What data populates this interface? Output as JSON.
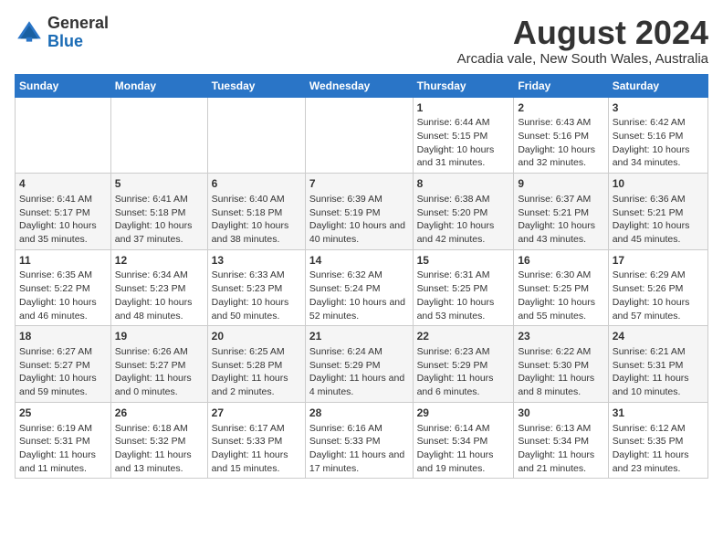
{
  "header": {
    "logo_general": "General",
    "logo_blue": "Blue",
    "month_year": "August 2024",
    "location": "Arcadia vale, New South Wales, Australia"
  },
  "days_of_week": [
    "Sunday",
    "Monday",
    "Tuesday",
    "Wednesday",
    "Thursday",
    "Friday",
    "Saturday"
  ],
  "weeks": [
    [
      {
        "day": "",
        "sunrise": "",
        "sunset": "",
        "daylight": ""
      },
      {
        "day": "",
        "sunrise": "",
        "sunset": "",
        "daylight": ""
      },
      {
        "day": "",
        "sunrise": "",
        "sunset": "",
        "daylight": ""
      },
      {
        "day": "",
        "sunrise": "",
        "sunset": "",
        "daylight": ""
      },
      {
        "day": "1",
        "sunrise": "Sunrise: 6:44 AM",
        "sunset": "Sunset: 5:15 PM",
        "daylight": "Daylight: 10 hours and 31 minutes."
      },
      {
        "day": "2",
        "sunrise": "Sunrise: 6:43 AM",
        "sunset": "Sunset: 5:16 PM",
        "daylight": "Daylight: 10 hours and 32 minutes."
      },
      {
        "day": "3",
        "sunrise": "Sunrise: 6:42 AM",
        "sunset": "Sunset: 5:16 PM",
        "daylight": "Daylight: 10 hours and 34 minutes."
      }
    ],
    [
      {
        "day": "4",
        "sunrise": "Sunrise: 6:41 AM",
        "sunset": "Sunset: 5:17 PM",
        "daylight": "Daylight: 10 hours and 35 minutes."
      },
      {
        "day": "5",
        "sunrise": "Sunrise: 6:41 AM",
        "sunset": "Sunset: 5:18 PM",
        "daylight": "Daylight: 10 hours and 37 minutes."
      },
      {
        "day": "6",
        "sunrise": "Sunrise: 6:40 AM",
        "sunset": "Sunset: 5:18 PM",
        "daylight": "Daylight: 10 hours and 38 minutes."
      },
      {
        "day": "7",
        "sunrise": "Sunrise: 6:39 AM",
        "sunset": "Sunset: 5:19 PM",
        "daylight": "Daylight: 10 hours and 40 minutes."
      },
      {
        "day": "8",
        "sunrise": "Sunrise: 6:38 AM",
        "sunset": "Sunset: 5:20 PM",
        "daylight": "Daylight: 10 hours and 42 minutes."
      },
      {
        "day": "9",
        "sunrise": "Sunrise: 6:37 AM",
        "sunset": "Sunset: 5:21 PM",
        "daylight": "Daylight: 10 hours and 43 minutes."
      },
      {
        "day": "10",
        "sunrise": "Sunrise: 6:36 AM",
        "sunset": "Sunset: 5:21 PM",
        "daylight": "Daylight: 10 hours and 45 minutes."
      }
    ],
    [
      {
        "day": "11",
        "sunrise": "Sunrise: 6:35 AM",
        "sunset": "Sunset: 5:22 PM",
        "daylight": "Daylight: 10 hours and 46 minutes."
      },
      {
        "day": "12",
        "sunrise": "Sunrise: 6:34 AM",
        "sunset": "Sunset: 5:23 PM",
        "daylight": "Daylight: 10 hours and 48 minutes."
      },
      {
        "day": "13",
        "sunrise": "Sunrise: 6:33 AM",
        "sunset": "Sunset: 5:23 PM",
        "daylight": "Daylight: 10 hours and 50 minutes."
      },
      {
        "day": "14",
        "sunrise": "Sunrise: 6:32 AM",
        "sunset": "Sunset: 5:24 PM",
        "daylight": "Daylight: 10 hours and 52 minutes."
      },
      {
        "day": "15",
        "sunrise": "Sunrise: 6:31 AM",
        "sunset": "Sunset: 5:25 PM",
        "daylight": "Daylight: 10 hours and 53 minutes."
      },
      {
        "day": "16",
        "sunrise": "Sunrise: 6:30 AM",
        "sunset": "Sunset: 5:25 PM",
        "daylight": "Daylight: 10 hours and 55 minutes."
      },
      {
        "day": "17",
        "sunrise": "Sunrise: 6:29 AM",
        "sunset": "Sunset: 5:26 PM",
        "daylight": "Daylight: 10 hours and 57 minutes."
      }
    ],
    [
      {
        "day": "18",
        "sunrise": "Sunrise: 6:27 AM",
        "sunset": "Sunset: 5:27 PM",
        "daylight": "Daylight: 10 hours and 59 minutes."
      },
      {
        "day": "19",
        "sunrise": "Sunrise: 6:26 AM",
        "sunset": "Sunset: 5:27 PM",
        "daylight": "Daylight: 11 hours and 0 minutes."
      },
      {
        "day": "20",
        "sunrise": "Sunrise: 6:25 AM",
        "sunset": "Sunset: 5:28 PM",
        "daylight": "Daylight: 11 hours and 2 minutes."
      },
      {
        "day": "21",
        "sunrise": "Sunrise: 6:24 AM",
        "sunset": "Sunset: 5:29 PM",
        "daylight": "Daylight: 11 hours and 4 minutes."
      },
      {
        "day": "22",
        "sunrise": "Sunrise: 6:23 AM",
        "sunset": "Sunset: 5:29 PM",
        "daylight": "Daylight: 11 hours and 6 minutes."
      },
      {
        "day": "23",
        "sunrise": "Sunrise: 6:22 AM",
        "sunset": "Sunset: 5:30 PM",
        "daylight": "Daylight: 11 hours and 8 minutes."
      },
      {
        "day": "24",
        "sunrise": "Sunrise: 6:21 AM",
        "sunset": "Sunset: 5:31 PM",
        "daylight": "Daylight: 11 hours and 10 minutes."
      }
    ],
    [
      {
        "day": "25",
        "sunrise": "Sunrise: 6:19 AM",
        "sunset": "Sunset: 5:31 PM",
        "daylight": "Daylight: 11 hours and 11 minutes."
      },
      {
        "day": "26",
        "sunrise": "Sunrise: 6:18 AM",
        "sunset": "Sunset: 5:32 PM",
        "daylight": "Daylight: 11 hours and 13 minutes."
      },
      {
        "day": "27",
        "sunrise": "Sunrise: 6:17 AM",
        "sunset": "Sunset: 5:33 PM",
        "daylight": "Daylight: 11 hours and 15 minutes."
      },
      {
        "day": "28",
        "sunrise": "Sunrise: 6:16 AM",
        "sunset": "Sunset: 5:33 PM",
        "daylight": "Daylight: 11 hours and 17 minutes."
      },
      {
        "day": "29",
        "sunrise": "Sunrise: 6:14 AM",
        "sunset": "Sunset: 5:34 PM",
        "daylight": "Daylight: 11 hours and 19 minutes."
      },
      {
        "day": "30",
        "sunrise": "Sunrise: 6:13 AM",
        "sunset": "Sunset: 5:34 PM",
        "daylight": "Daylight: 11 hours and 21 minutes."
      },
      {
        "day": "31",
        "sunrise": "Sunrise: 6:12 AM",
        "sunset": "Sunset: 5:35 PM",
        "daylight": "Daylight: 11 hours and 23 minutes."
      }
    ]
  ]
}
